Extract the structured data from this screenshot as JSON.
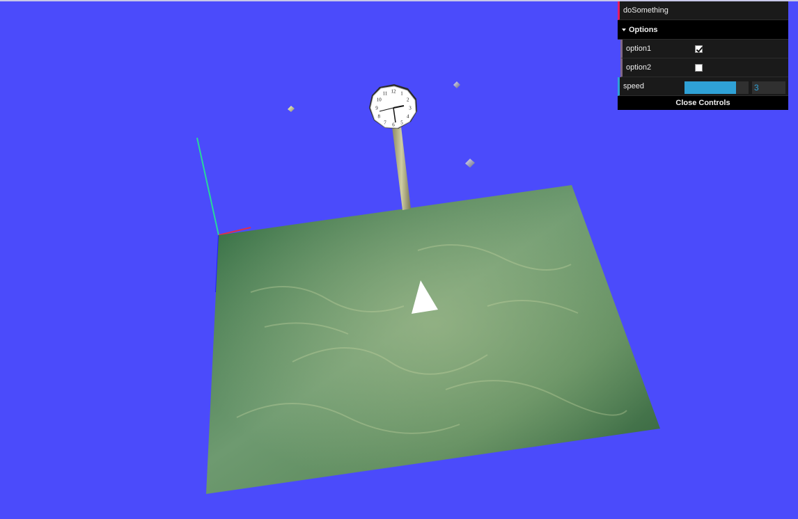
{
  "gui": {
    "function_label": "doSomething",
    "folder_label": "Options",
    "option1": {
      "label": "option1",
      "checked": true
    },
    "option2": {
      "label": "option2",
      "checked": false
    },
    "speed": {
      "label": "speed",
      "value": "3",
      "fraction": 0.8
    },
    "close_label": "Close Controls"
  },
  "scene": {
    "background_color": "#4b4bfb",
    "clock_numerals": [
      "12",
      "1",
      "2",
      "3",
      "4",
      "5",
      "6",
      "7",
      "8",
      "9",
      "10",
      "11"
    ]
  }
}
